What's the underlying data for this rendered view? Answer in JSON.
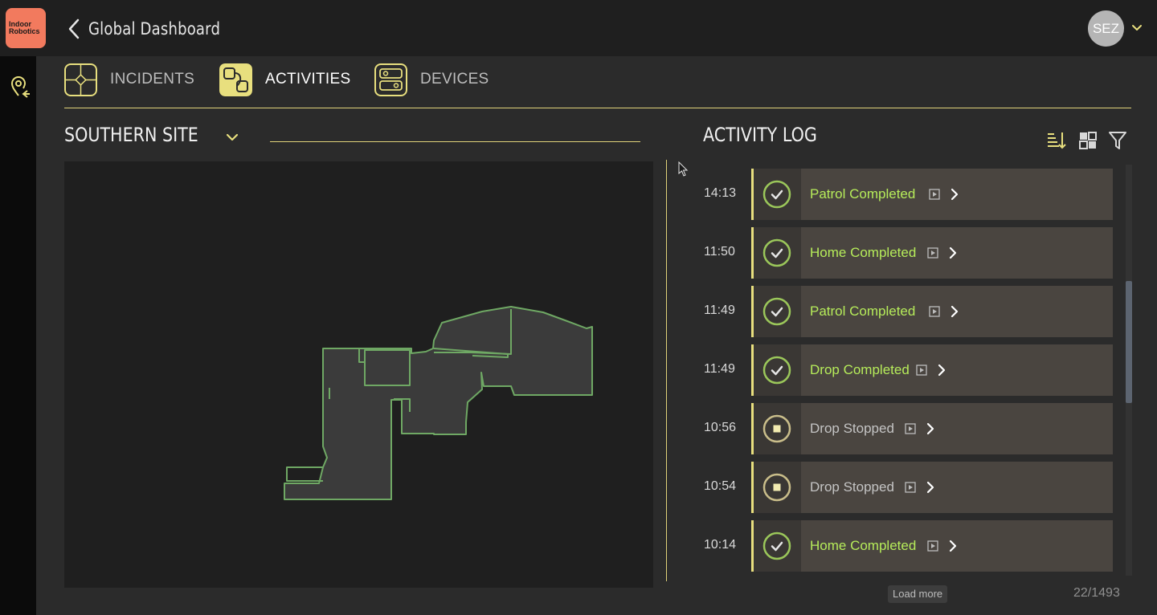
{
  "colors": {
    "accent": "#e8df7e",
    "success": "#b6ec5a",
    "logo": "#f27a5e",
    "map_outline": "#6fa864"
  },
  "logo": {
    "line1": "Indoor",
    "line2": "Robotics"
  },
  "header": {
    "title": "Global Dashboard",
    "user_initials": "SEZ"
  },
  "tabs": [
    {
      "label": "INCIDENTS",
      "icon": "incidents-icon",
      "active": false
    },
    {
      "label": "ACTIVITIES",
      "icon": "activities-icon",
      "active": true
    },
    {
      "label": "DEVICES",
      "icon": "devices-icon",
      "active": false
    }
  ],
  "site": {
    "name": "SOUTHERN SITE"
  },
  "activity_log": {
    "title": "ACTIVITY LOG",
    "tools": [
      "sort-icon",
      "layout-icon",
      "filter-icon"
    ],
    "items": [
      {
        "time": "14:13",
        "label": "Patrol Completed",
        "status": "completed"
      },
      {
        "time": "11:50",
        "label": "Home Completed",
        "status": "completed"
      },
      {
        "time": "11:49",
        "label": "Patrol Completed",
        "status": "completed"
      },
      {
        "time": "11:49",
        "label": "Drop Completed",
        "status": "completed"
      },
      {
        "time": "10:56",
        "label": "Drop Stopped",
        "status": "stopped"
      },
      {
        "time": "10:54",
        "label": "Drop Stopped",
        "status": "stopped"
      },
      {
        "time": "10:14",
        "label": "Home Completed",
        "status": "completed"
      }
    ],
    "load_more": "Load more",
    "counter": "22/1493"
  }
}
